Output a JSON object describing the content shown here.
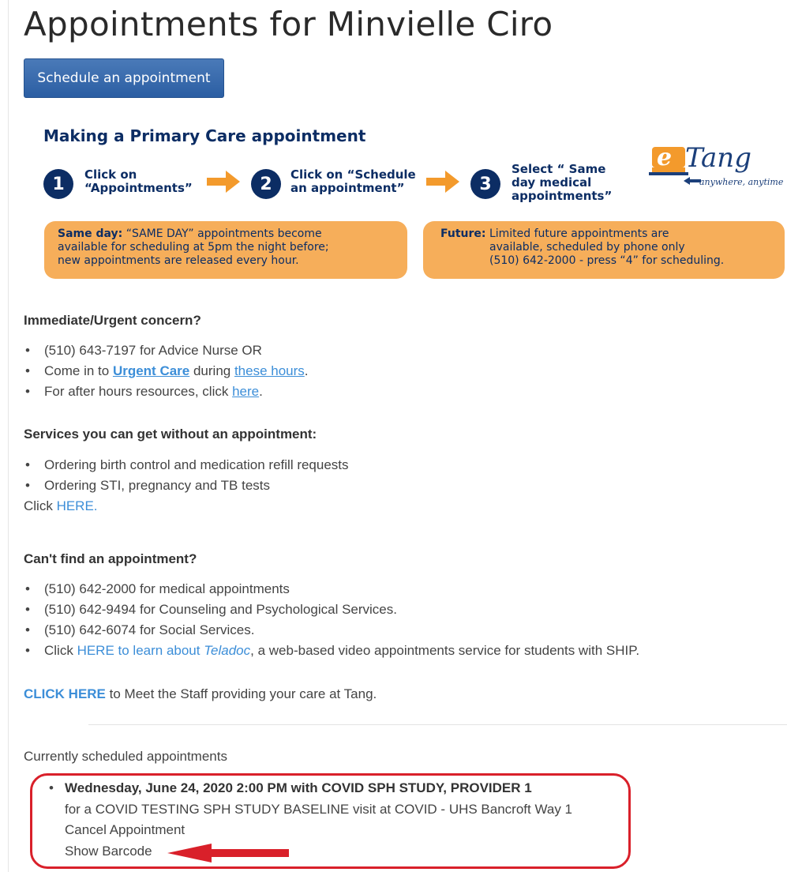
{
  "page_title": "Appointments for Minvielle Ciro",
  "schedule_button": "Schedule an appointment",
  "banner": {
    "title": "Making a Primary Care appointment",
    "steps": [
      {
        "num": "1",
        "text": "Click on\n“Appointments”"
      },
      {
        "num": "2",
        "text": "Click on “Schedule\nan appointment”"
      },
      {
        "num": "3",
        "text": "Select “ Same\nday medical\nappointments”"
      }
    ],
    "logo": {
      "e": "e",
      "name": "Tang",
      "tagline": "anywhere, anytime"
    },
    "same_day": {
      "label": "Same day:",
      "line1": " “SAME DAY” appointments become",
      "line2": "available for scheduling at 5pm the night before;",
      "line3": "new appointments are released every hour."
    },
    "future": {
      "label": "Future:",
      "line1": " Limited future appointments are",
      "line2": "available, scheduled by phone only",
      "line3": "(510) 642-2000 - press “4” for scheduling."
    }
  },
  "urgent": {
    "title": "Immediate/Urgent concern?",
    "item1": "(510) 643-7197 for Advice Nurse OR",
    "item2_pre": "Come in to ",
    "item2_link1": "Urgent Care",
    "item2_mid": " during ",
    "item2_link2": "these hours",
    "item2_post": ".",
    "item3_pre": "For after hours resources, click ",
    "item3_link": "here",
    "item3_post": "."
  },
  "services": {
    "title": "Services you can get without an appointment:",
    "item1": "Ordering birth control and medication refill requests",
    "item2": "Ordering STI, pregnancy and TB tests",
    "click_pre": "Click ",
    "click_link": "HERE."
  },
  "cant_find": {
    "title": "Can't find an appointment?",
    "item1": "(510) 642-2000 for medical appointments",
    "item2": "(510) 642-9494 for Counseling and Psychological Services.",
    "item3": "(510) 642-6074 for Social Services.",
    "item4_pre": "Click ",
    "item4_link": "HERE to learn about ",
    "item4_link_italic": "Teladoc",
    "item4_post": ", a web-based video appointments service for students with SHIP."
  },
  "meet_staff": {
    "link": "CLICK HERE",
    "text": " to Meet the Staff providing your care at Tang."
  },
  "scheduled": {
    "title": "Currently scheduled appointments",
    "appointment": {
      "when": "Wednesday, June 24, 2020 2:00 PM with COVID SPH STUDY, PROVIDER 1",
      "details": "for a COVID TESTING SPH STUDY BASELINE visit at COVID - UHS Bancroft Way 1",
      "cancel": "Cancel Appointment",
      "barcode": "Show Barcode"
    }
  },
  "colors": {
    "primary_button": "#2b5ea3",
    "navy": "#0c2d64",
    "orange": "#f6ae5a",
    "arrow_orange": "#f39a2c",
    "link": "#3c8ed8",
    "highlight_red": "#d9202a"
  }
}
